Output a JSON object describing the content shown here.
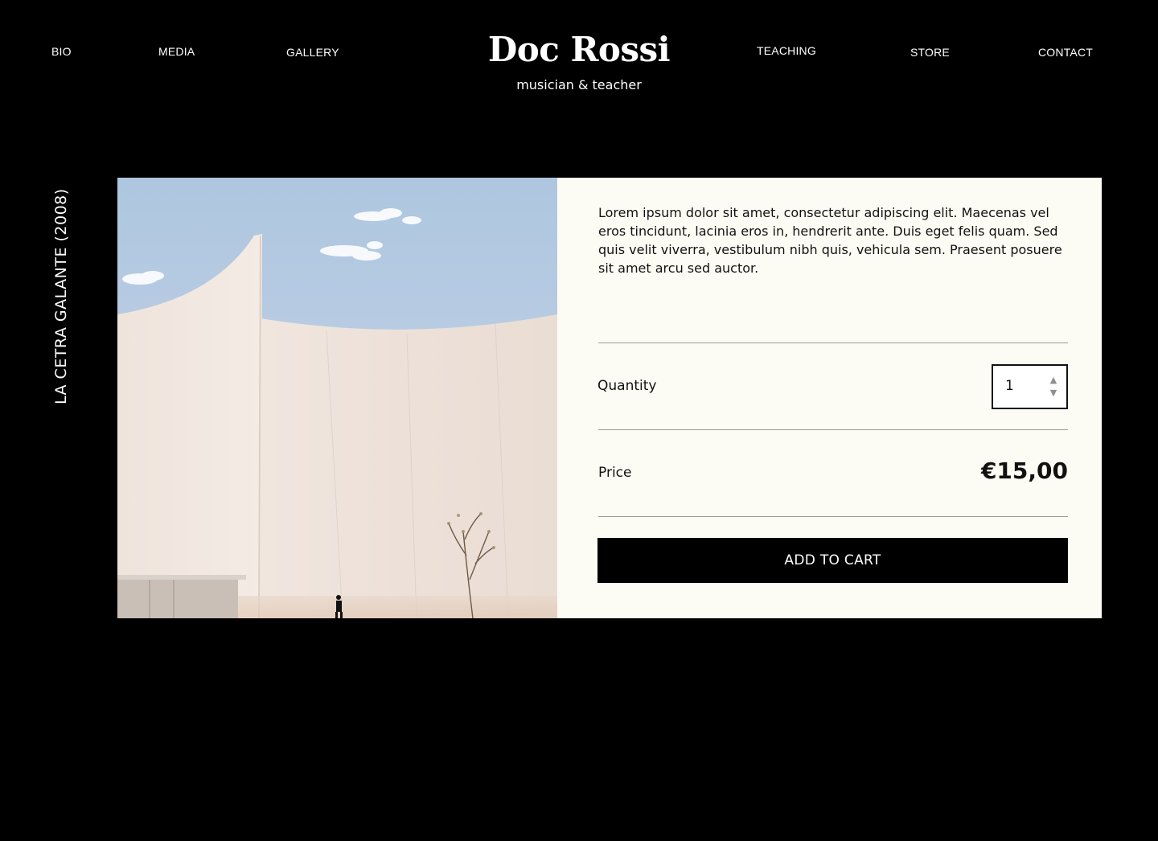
{
  "nav": {
    "bio": "BIO",
    "media": "MEDIA",
    "gallery": "GALLERY",
    "teaching": "TEACHING",
    "store": "STORE",
    "contact": "CONTACT"
  },
  "brand": {
    "title": "Doc Rossi",
    "subtitle": "musician & teacher"
  },
  "product": {
    "title": "LA CETRA GALANTE (2008)",
    "description": "Lorem ipsum dolor sit amet, consectetur adipiscing elit. Maecenas vel eros tincidunt, lacinia eros in, hendrerit ante. Duis eget felis quam. Sed quis velit viverra, vestibulum nibh quis, vehicula sem. Praesent posuere sit amet arcu sed auctor.",
    "quantity_label": "Quantity",
    "quantity_value": "1",
    "price_label": "Price",
    "price_value": "€15,00",
    "add_to_cart_label": "ADD TO CART"
  },
  "icons": {
    "stepper_up": "triangle-up-icon",
    "stepper_down": "triangle-down-icon"
  },
  "colors": {
    "page_background": "#000000",
    "card_background": "#fdfcf4",
    "button_background": "#000000",
    "button_text": "#ffffff"
  }
}
